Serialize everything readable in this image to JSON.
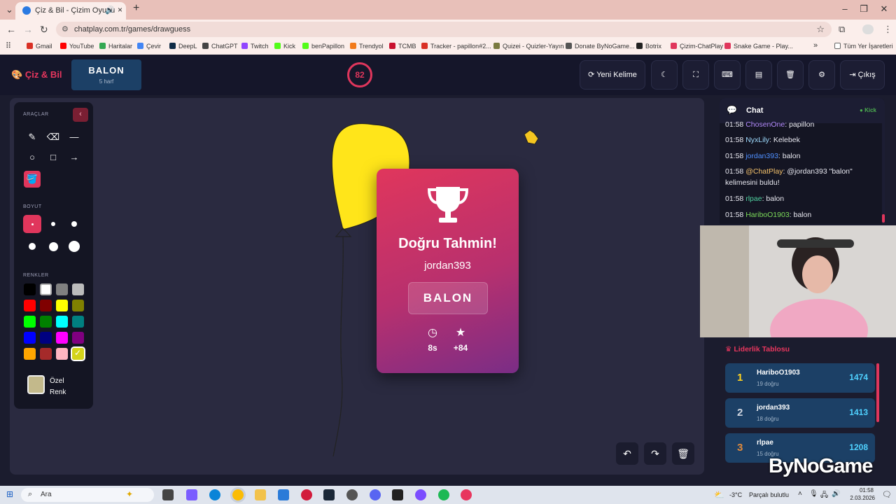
{
  "browser": {
    "tab_title": "Çiz & Bil - Çizim Oyunu",
    "new_tab": "+",
    "url": "chatplay.com.tr/games/drawguess",
    "bookmarks": [
      {
        "label": "Gmail",
        "color": "#d93025"
      },
      {
        "label": "YouTube",
        "color": "#ff0000"
      },
      {
        "label": "Haritalar",
        "color": "#34a853"
      },
      {
        "label": "Çevir",
        "color": "#4285f4"
      },
      {
        "label": "DeepL",
        "color": "#0f2b46"
      },
      {
        "label": "ChatGPT",
        "color": "#444444"
      },
      {
        "label": "Twitch",
        "color": "#9146ff"
      },
      {
        "label": "Kick",
        "color": "#53fc18"
      },
      {
        "label": "benPapillon",
        "color": "#53fc18"
      },
      {
        "label": "Trendyol",
        "color": "#f27a1a"
      },
      {
        "label": "TCMB",
        "color": "#c8102e"
      },
      {
        "label": "Tracker - papillon#2...",
        "color": "#d93025"
      },
      {
        "label": "Quizei - Quizler-Yayın",
        "color": "#7a7a40"
      },
      {
        "label": "Donate ByNoGame...",
        "color": "#555555"
      },
      {
        "label": "Botrix",
        "color": "#222222"
      },
      {
        "label": "Çizim-ChatPlay",
        "color": "#e0365c"
      },
      {
        "label": "Snake Game - Play...",
        "color": "#e0365c"
      }
    ],
    "all_bookmarks": "Tüm Yer İşaretleri"
  },
  "header": {
    "logo": "Çiz & Bil",
    "word": "BALON",
    "letters": "5 harf",
    "timer": "82",
    "new_word": "Yeni Kelime",
    "exit": "Çıkış"
  },
  "tools": {
    "section_tools": "ARAÇLAR",
    "section_size": "BOYUT",
    "section_colors": "RENKLER",
    "custom_color_label": "Özel Renk",
    "custom_color": "#c3b98b",
    "palette": [
      "#000000",
      "#ffffff",
      "#808080",
      "#bbbbbb",
      "#ff0000",
      "#800000",
      "#ffff00",
      "#808000",
      "#00ff00",
      "#008000",
      "#00ffff",
      "#008080",
      "#0000ff",
      "#000080",
      "#ff00ff",
      "#800080",
      "#ffa500",
      "#a52a2a",
      "#ffb6c1",
      "#f0e68c"
    ]
  },
  "popup": {
    "title": "Doğru Tahmin!",
    "user": "jordan393",
    "word": "BALON",
    "time": "8s",
    "points": "+84"
  },
  "chat": {
    "title": "Chat",
    "platform": "Kick",
    "messages": [
      {
        "time": "01:58",
        "user": "ChosenOne",
        "color": "#b48cff",
        "text": ": papillon"
      },
      {
        "time": "01:58",
        "user": "NyxLily",
        "color": "#9fdcff",
        "text": ": Kelebek"
      },
      {
        "time": "01:58",
        "user": "jordan393",
        "color": "#4f8fff",
        "text": ": balon"
      },
      {
        "time": "01:58",
        "user": "@ChatPlay",
        "color": "#f5c26b",
        "text": ": @jordan393 \"balon\" kelimesini buldu!"
      },
      {
        "time": "01:58",
        "user": "rlpae",
        "color": "#4fd1a0",
        "text": ": balon"
      },
      {
        "time": "01:58",
        "user": "HariboO1903",
        "color": "#7ddc5a",
        "text": ": balon"
      }
    ]
  },
  "leaderboard": {
    "title": "Liderlik Tablosu",
    "rows": [
      {
        "rank": "1",
        "name": "HariboO1903",
        "count": "19 doğru",
        "score": "1474",
        "rank_color": "#ffd21f"
      },
      {
        "rank": "2",
        "name": "jordan393",
        "count": "18 doğru",
        "score": "1413",
        "rank_color": "#d0d6e0"
      },
      {
        "rank": "3",
        "name": "rlpae",
        "count": "15 doğru",
        "score": "1208",
        "rank_color": "#e08a3c"
      }
    ]
  },
  "overlay_brand": "ByNoGame",
  "taskbar": {
    "search": "Ara",
    "weather": "-3°C",
    "weather_text": "Parçalı bulutlu",
    "time": "01:58",
    "date": "2.03.2026"
  }
}
